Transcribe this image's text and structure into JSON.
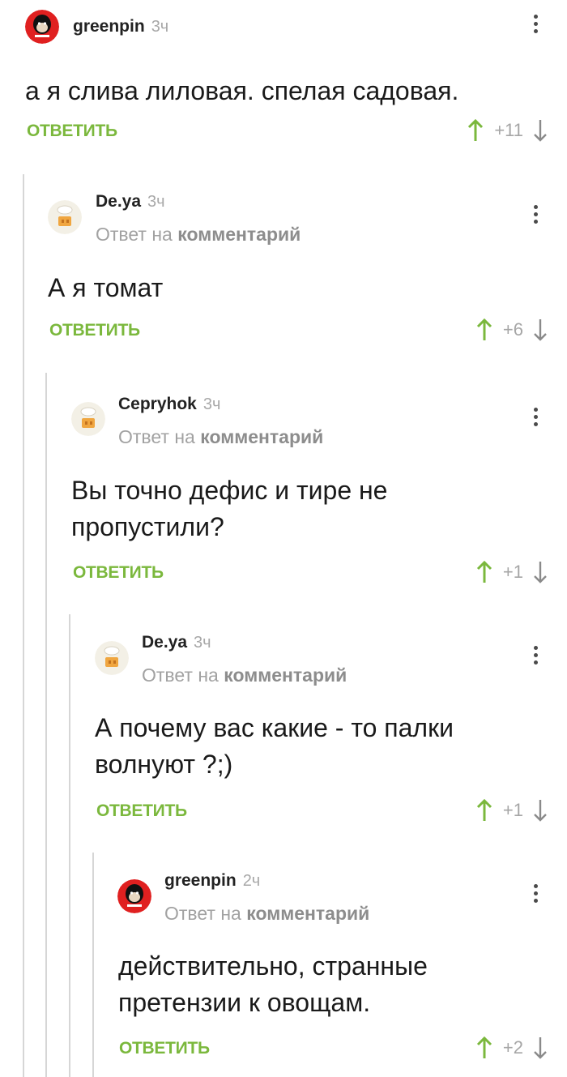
{
  "comments": [
    {
      "username": "greenpin",
      "time": "3ч",
      "avatar": "monkey",
      "reply_prefix": "",
      "reply_target": "",
      "lines": [
        "а я слива лиловая. спелая садовая."
      ],
      "reply_label": "ОТВЕТИТЬ",
      "rating": "+11"
    },
    {
      "username": "De.ya",
      "time": "3ч",
      "avatar": "chef",
      "reply_prefix": "Ответ на",
      "reply_target": "комментарий",
      "lines": [
        "А я томат"
      ],
      "reply_label": "ОТВЕТИТЬ",
      "rating": "+6"
    },
    {
      "username": "Cepryhok",
      "time": "3ч",
      "avatar": "chef",
      "reply_prefix": "Ответ на",
      "reply_target": "комментарий",
      "lines": [
        "Вы точно дефис и тире не",
        "пропустили?"
      ],
      "reply_label": "ОТВЕТИТЬ",
      "rating": "+1"
    },
    {
      "username": "De.ya",
      "time": "3ч",
      "avatar": "chef",
      "reply_prefix": "Ответ на",
      "reply_target": "комментарий",
      "lines": [
        "А почему вас какие - то палки",
        "волнуют ?;)"
      ],
      "reply_label": "ОТВЕТИТЬ",
      "rating": "+1"
    },
    {
      "username": "greenpin",
      "time": "2ч",
      "avatar": "monkey",
      "reply_prefix": "Ответ на",
      "reply_target": "комментарий",
      "lines": [
        "действительно, странные",
        "претензии к овощам."
      ],
      "reply_label": "ОТВЕТИТЬ",
      "rating": "+2"
    }
  ],
  "colors": {
    "accent_green": "#7bb83d",
    "upvote_green": "#7bb83d",
    "muted": "#a6a6a6",
    "thread_line": "#d6d6d6"
  },
  "icons": {
    "upvote": "arrow-up-icon",
    "downvote": "arrow-down-icon",
    "menu": "kebab-menu-icon"
  }
}
